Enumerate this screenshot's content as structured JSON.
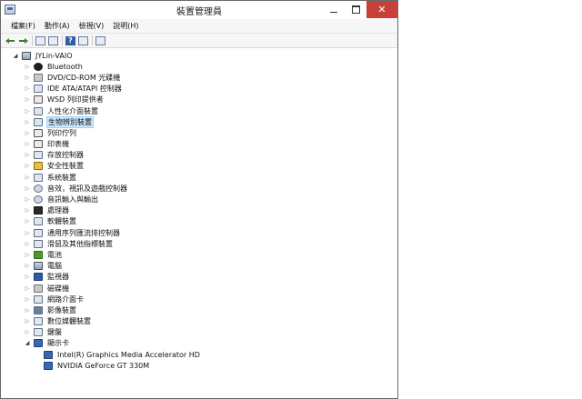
{
  "window": {
    "title": "裝置管理員",
    "close_symbol": "✕"
  },
  "menu": [
    {
      "label": "檔案(F)"
    },
    {
      "label": "動作(A)"
    },
    {
      "label": "檢視(V)"
    },
    {
      "label": "說明(H)"
    }
  ],
  "toolbar": {
    "icons": [
      "back-arrow-icon",
      "forward-arrow-icon",
      "properties-icon",
      "console-icon",
      "help-icon",
      "view-icon",
      "scan-icon"
    ],
    "help_glyph": "?"
  },
  "tree": {
    "root": {
      "label": "JYLin-VAIO",
      "expanded": true
    },
    "categories": [
      {
        "label": "Bluetooth",
        "icon": "bluetooth-icon"
      },
      {
        "label": "DVD/CD-ROM 光碟機",
        "icon": "disk-drive-icon"
      },
      {
        "label": "IDE ATA/ATAPI 控制器",
        "icon": "controller-icon"
      },
      {
        "label": "WSD 列印提供者",
        "icon": "printer-icon"
      },
      {
        "label": "人性化介面裝置",
        "icon": "hid-icon"
      },
      {
        "label": "生物辨別裝置",
        "icon": "biometric-icon",
        "selected": true
      },
      {
        "label": "列印佇列",
        "icon": "printer-icon"
      },
      {
        "label": "印表機",
        "icon": "printer-icon"
      },
      {
        "label": "存放控制器",
        "icon": "storage-icon"
      },
      {
        "label": "安全性裝置",
        "icon": "security-icon"
      },
      {
        "label": "系統裝置",
        "icon": "system-icon"
      },
      {
        "label": "音效，視訊及遊戲控制器",
        "icon": "sound-icon"
      },
      {
        "label": "音訊輸入與輸出",
        "icon": "audio-icon"
      },
      {
        "label": "處理器",
        "icon": "processor-icon"
      },
      {
        "label": "軟體裝置",
        "icon": "software-device-icon"
      },
      {
        "label": "通用序列匯流排控制器",
        "icon": "usb-icon"
      },
      {
        "label": "滑鼠及其他指標裝置",
        "icon": "mouse-icon"
      },
      {
        "label": "電池",
        "icon": "battery-icon"
      },
      {
        "label": "電腦",
        "icon": "computer-icon"
      },
      {
        "label": "監視器",
        "icon": "monitor-icon"
      },
      {
        "label": "磁碟機",
        "icon": "disk-icon"
      },
      {
        "label": "網路介面卡",
        "icon": "network-icon"
      },
      {
        "label": "影像裝置",
        "icon": "camera-icon"
      },
      {
        "label": "數位媒體裝置",
        "icon": "media-icon"
      },
      {
        "label": "鍵盤",
        "icon": "keyboard-icon"
      }
    ],
    "expanded_category": {
      "label": "顯示卡",
      "icon": "display-adapter-icon",
      "children": [
        {
          "label": "Intel(R) Graphics Media Accelerator HD",
          "icon": "display-adapter-icon"
        },
        {
          "label": "NVIDIA GeForce GT 330M",
          "icon": "display-adapter-icon"
        }
      ]
    }
  },
  "colors": {
    "close_button": "#c7413a",
    "selection": "#cce8ff",
    "selection_border": "#99d1ff"
  }
}
